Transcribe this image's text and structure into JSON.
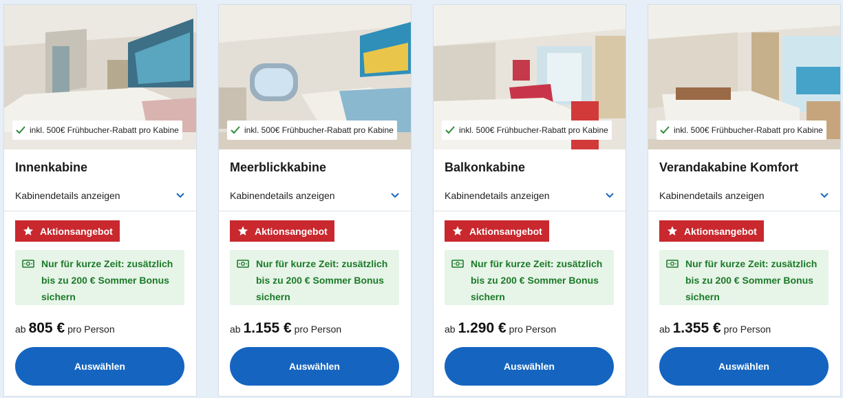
{
  "cabins": [
    {
      "image_alt": "Innenkabine",
      "discount_badge": "inkl. 500€ Frühbucher-Rabatt pro Kabine",
      "title": "Innenkabine",
      "details_link": "Kabinendetails anzeigen",
      "promo_label": "Aktionsangebot",
      "bonus_text": "Nur für kurze Zeit: zusätzlich bis zu 200 € Sommer Bonus sichern",
      "price_prefix": "ab",
      "price": "805 €",
      "price_suffix": "pro Person",
      "select_button": "Auswählen"
    },
    {
      "image_alt": "Meerblickkabine",
      "discount_badge": "inkl. 500€ Frühbucher-Rabatt pro Kabine",
      "title": "Meerblickkabine",
      "details_link": "Kabinendetails anzeigen",
      "promo_label": "Aktionsangebot",
      "bonus_text": "Nur für kurze Zeit: zusätzlich bis zu 200 € Sommer Bonus sichern",
      "price_prefix": "ab",
      "price": "1.155 €",
      "price_suffix": "pro Person",
      "select_button": "Auswählen"
    },
    {
      "image_alt": "Balkonkabine",
      "discount_badge": "inkl. 500€ Frühbucher-Rabatt pro Kabine",
      "title": "Balkonkabine",
      "details_link": "Kabinendetails anzeigen",
      "promo_label": "Aktionsangebot",
      "bonus_text": "Nur für kurze Zeit: zusätzlich bis zu 200 € Sommer Bonus sichern",
      "price_prefix": "ab",
      "price": "1.290 €",
      "price_suffix": "pro Person",
      "select_button": "Auswählen"
    },
    {
      "image_alt": "Verandakabine Komfort",
      "discount_badge": "inkl. 500€ Frühbucher-Rabatt pro Kabine",
      "title": "Verandakabine Komfort",
      "details_link": "Kabinendetails anzeigen",
      "promo_label": "Aktionsangebot",
      "bonus_text": "Nur für kurze Zeit: zusätzlich bis zu 200 € Sommer Bonus sichern",
      "price_prefix": "ab",
      "price": "1.355 €",
      "price_suffix": "pro Person",
      "select_button": "Auswählen"
    }
  ],
  "icons": {
    "check": "check-icon",
    "chevron": "chevron-down-icon",
    "star": "star-icon",
    "money": "money-icon"
  },
  "colors": {
    "page_bg": "#e6eef8",
    "accent_blue": "#1565c0",
    "promo_red": "#c8282e",
    "bonus_green": "#1a7a27",
    "bonus_bg": "#e7f4e8",
    "check_green": "#2e8b3a"
  }
}
